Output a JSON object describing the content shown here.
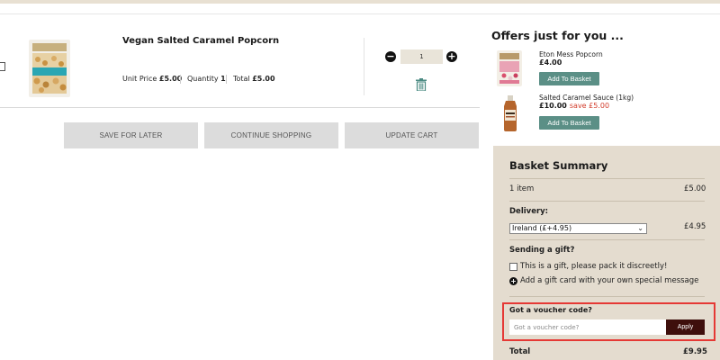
{
  "product": {
    "title": "Vegan Salted Caramel Popcorn",
    "unit_price_label": "Unit Price",
    "unit_price": "£5.00",
    "quantity_label": "Quantity",
    "quantity": "1",
    "total_label": "Total",
    "total": "£5.00",
    "qty_value": "1"
  },
  "actions": {
    "save_for_later": "SAVE FOR LATER",
    "continue_shopping": "CONTINUE SHOPPING",
    "update_cart": "UPDATE CART"
  },
  "offers": {
    "title": "Offers just for you ...",
    "items": [
      {
        "name": "Eton Mess Popcorn",
        "price": "£4.00",
        "save": "",
        "button": "Add To Basket"
      },
      {
        "name": "Salted Caramel Sauce (1kg)",
        "price": "£10.00",
        "save": "save £5.00",
        "button": "Add To Basket"
      }
    ]
  },
  "summary": {
    "title": "Basket Summary",
    "items_label": "1 item",
    "items_value": "£5.00",
    "delivery_label": "Delivery:",
    "delivery_option": "Ireland (£+4.95)",
    "delivery_value": "£4.95",
    "gift_title": "Sending a gift?",
    "gift_checkbox_label": "This is a gift, please pack it discreetly!",
    "gift_card_label": "Add a gift card with your own special message",
    "voucher_title": "Got a voucher code?",
    "voucher_placeholder": "Got a voucher code?",
    "apply_label": "Apply",
    "total_label": "Total",
    "total_value": "£9.95"
  },
  "colors": {
    "summary_bg": "#e4dccf",
    "offer_button": "#5b8f86",
    "apply_button": "#3e0f0c",
    "highlight_border": "#e53935",
    "save_text": "#d23b2a"
  }
}
